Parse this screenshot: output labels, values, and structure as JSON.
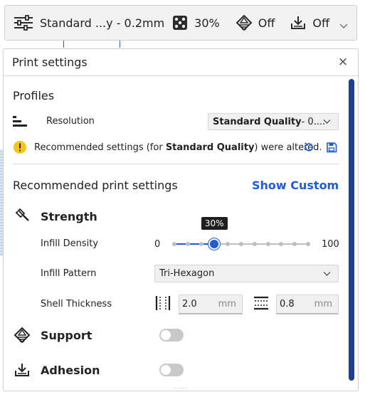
{
  "toolbar": {
    "profile_label": "Standard ...y - 0.2mm",
    "infill_label": "30%",
    "support_label": "Off",
    "adhesion_label": "Off"
  },
  "panel": {
    "title": "Print settings",
    "close_glyph": "×",
    "grip_glyph": "....."
  },
  "profiles": {
    "heading": "Profiles",
    "resolution_label": "Resolution",
    "resolution_value_bold": "Standard Quality",
    "resolution_value_rest": " - 0....",
    "warning_prefix": "Recommended settings (for ",
    "warning_bold": "Standard Quality",
    "warning_suffix": ") were altered."
  },
  "recommended": {
    "heading": "Recommended print settings",
    "show_custom": "Show Custom"
  },
  "strength": {
    "heading": "Strength",
    "infill_density_label": "Infill Density",
    "slider_min": "0",
    "slider_max": "100",
    "slider_value": 30,
    "slider_tooltip": "30%",
    "infill_pattern_label": "Infill Pattern",
    "infill_pattern_value": "Tri-Hexagon",
    "shell_thickness_label": "Shell Thickness",
    "wall_value": "2.0",
    "wall_unit": "mm",
    "topbottom_value": "0.8",
    "topbottom_unit": "mm"
  },
  "support": {
    "heading": "Support",
    "enabled": false
  },
  "adhesion": {
    "heading": "Adhesion",
    "enabled": false
  },
  "colors": {
    "accent": "#1e5bd8",
    "warning": "#f5c518",
    "scrollbar": "#1f3f8f"
  }
}
